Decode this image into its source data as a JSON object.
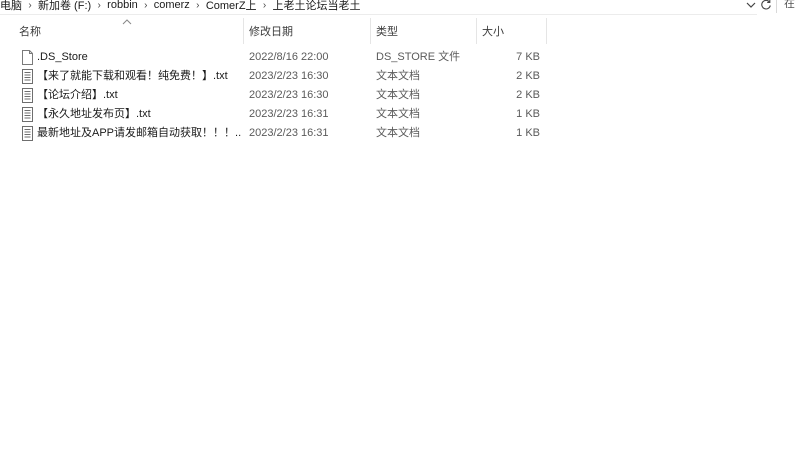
{
  "address_bar": {
    "crumbs": [
      "电脑",
      "新加卷 (F:)",
      "robbin",
      "comerz",
      "ComerZ上",
      "上老土论坛当老土"
    ],
    "separator": "›",
    "search_placeholder": "在"
  },
  "columns": {
    "name": "名称",
    "date": "修改日期",
    "type": "类型",
    "size": "大小"
  },
  "files": [
    {
      "name": ".DS_Store",
      "date": "2022/8/16 22:00",
      "type": "DS_STORE 文件",
      "size": "7 KB",
      "icon": "blank-file-icon"
    },
    {
      "name": "【来了就能下载和观看！纯免费！】.txt",
      "date": "2023/2/23 16:30",
      "type": "文本文档",
      "size": "2 KB",
      "icon": "text-file-icon"
    },
    {
      "name": "【论坛介绍】.txt",
      "date": "2023/2/23 16:30",
      "type": "文本文档",
      "size": "2 KB",
      "icon": "text-file-icon"
    },
    {
      "name": "【永久地址发布页】.txt",
      "date": "2023/2/23 16:31",
      "type": "文本文档",
      "size": "1 KB",
      "icon": "text-file-icon"
    },
    {
      "name": "最新地址及APP请发邮箱自动获取！！！...",
      "date": "2023/2/23 16:31",
      "type": "文本文档",
      "size": "1 KB",
      "icon": "text-file-icon"
    }
  ]
}
